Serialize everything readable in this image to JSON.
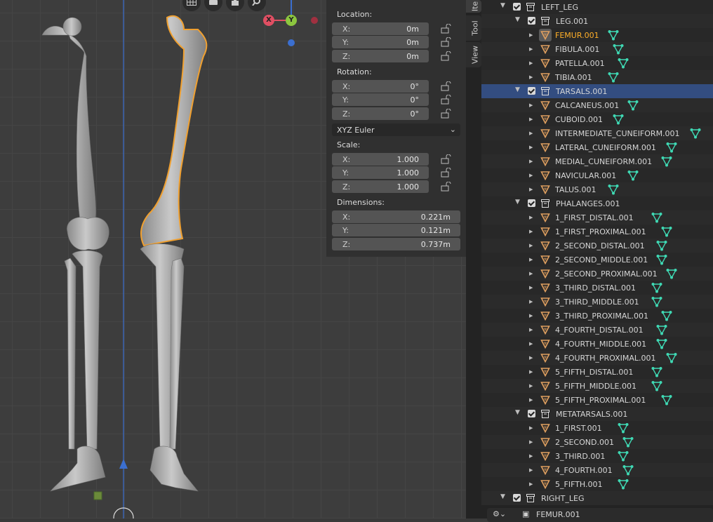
{
  "viewport": {
    "gizmo": {
      "x_label": "X",
      "y_label": "Y"
    }
  },
  "npanel": {
    "location_label": "Location:",
    "location": [
      {
        "axis": "X:",
        "value": "0m"
      },
      {
        "axis": "Y:",
        "value": "0m"
      },
      {
        "axis": "Z:",
        "value": "0m"
      }
    ],
    "rotation_label": "Rotation:",
    "rotation": [
      {
        "axis": "X:",
        "value": "0°"
      },
      {
        "axis": "Y:",
        "value": "0°"
      },
      {
        "axis": "Z:",
        "value": "0°"
      }
    ],
    "rotation_mode": "XYZ Euler",
    "scale_label": "Scale:",
    "scale": [
      {
        "axis": "X:",
        "value": "1.000"
      },
      {
        "axis": "Y:",
        "value": "1.000"
      },
      {
        "axis": "Z:",
        "value": "1.000"
      }
    ],
    "dimensions_label": "Dimensions:",
    "dimensions": [
      {
        "axis": "X:",
        "value": "0.221m"
      },
      {
        "axis": "Y:",
        "value": "0.121m"
      },
      {
        "axis": "Z:",
        "value": "0.737m"
      }
    ]
  },
  "tabs": [
    "Ite",
    "Tool",
    "View"
  ],
  "outliner": {
    "rows": [
      {
        "type": "collection",
        "name": "LEFT_LEG",
        "depth": 0,
        "expanded": true
      },
      {
        "type": "collection",
        "name": "LEG.001",
        "depth": 1,
        "expanded": true
      },
      {
        "type": "object",
        "name": "FEMUR.001",
        "depth": 2,
        "active": true
      },
      {
        "type": "object",
        "name": "FIBULA.001",
        "depth": 2
      },
      {
        "type": "object",
        "name": "PATELLA.001",
        "depth": 2
      },
      {
        "type": "object",
        "name": "TIBIA.001",
        "depth": 2
      },
      {
        "type": "collection",
        "name": "TARSALS.001",
        "depth": 1,
        "expanded": true,
        "selected": true
      },
      {
        "type": "object",
        "name": "CALCANEUS.001",
        "depth": 2
      },
      {
        "type": "object",
        "name": "CUBOID.001",
        "depth": 2
      },
      {
        "type": "object",
        "name": "INTERMEDIATE_CUNEIFORM.001",
        "depth": 2
      },
      {
        "type": "object",
        "name": "LATERAL_CUNEIFORM.001",
        "depth": 2
      },
      {
        "type": "object",
        "name": "MEDIAL_CUNEIFORM.001",
        "depth": 2
      },
      {
        "type": "object",
        "name": "NAVICULAR.001",
        "depth": 2
      },
      {
        "type": "object",
        "name": "TALUS.001",
        "depth": 2
      },
      {
        "type": "collection",
        "name": "PHALANGES.001",
        "depth": 1,
        "expanded": true
      },
      {
        "type": "object",
        "name": "1_FIRST_DISTAL.001",
        "depth": 2
      },
      {
        "type": "object",
        "name": "1_FIRST_PROXIMAL.001",
        "depth": 2
      },
      {
        "type": "object",
        "name": "2_SECOND_DISTAL.001",
        "depth": 2
      },
      {
        "type": "object",
        "name": "2_SECOND_MIDDLE.001",
        "depth": 2
      },
      {
        "type": "object",
        "name": "2_SECOND_PROXIMAL.001",
        "depth": 2
      },
      {
        "type": "object",
        "name": "3_THIRD_DISTAL.001",
        "depth": 2
      },
      {
        "type": "object",
        "name": "3_THIRD_MIDDLE.001",
        "depth": 2
      },
      {
        "type": "object",
        "name": "3_THIRD_PROXIMAL.001",
        "depth": 2
      },
      {
        "type": "object",
        "name": "4_FOURTH_DISTAL.001",
        "depth": 2
      },
      {
        "type": "object",
        "name": "4_FOURTH_MIDDLE.001",
        "depth": 2
      },
      {
        "type": "object",
        "name": "4_FOURTH_PROXIMAL.001",
        "depth": 2
      },
      {
        "type": "object",
        "name": "5_FIFTH_DISTAL.001",
        "depth": 2
      },
      {
        "type": "object",
        "name": "5_FIFTH_MIDDLE.001",
        "depth": 2
      },
      {
        "type": "object",
        "name": "5_FIFTH_PROXIMAL.001",
        "depth": 2
      },
      {
        "type": "collection",
        "name": "METATARSALS.001",
        "depth": 1,
        "expanded": true
      },
      {
        "type": "object",
        "name": "1_FIRST.001",
        "depth": 2
      },
      {
        "type": "object",
        "name": "2_SECOND.001",
        "depth": 2
      },
      {
        "type": "object",
        "name": "3_THIRD.001",
        "depth": 2
      },
      {
        "type": "object",
        "name": "4_FOURTH.001",
        "depth": 2
      },
      {
        "type": "object",
        "name": "5_FIFTH.001",
        "depth": 2
      },
      {
        "type": "collection",
        "name": "RIGHT_LEG",
        "depth": 0,
        "expanded": true
      }
    ],
    "footer_text": "FEMUR.001"
  },
  "colors": {
    "accent_selected": "#334d80",
    "active_object": "#ffaf29",
    "mesh_icon": "#e0a060",
    "mesh_data": "#3fd9b4",
    "selection_outline": "#f0a030"
  }
}
